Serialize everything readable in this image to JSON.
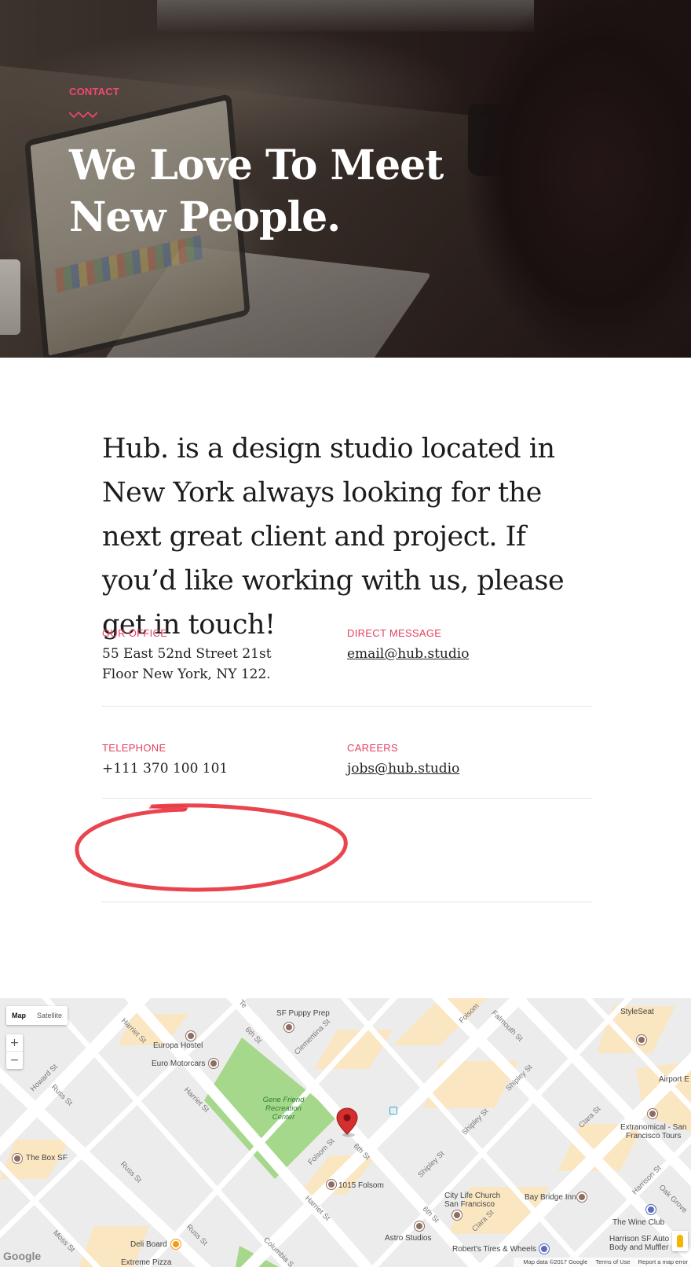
{
  "hero": {
    "eyebrow": "CONTACT",
    "title": "We Love To Meet New People."
  },
  "intro": "Hub. is a design studio located in New York always looking for the next great client and project. If you’d like working with us, please get in touch!",
  "contact": {
    "office_label": "OUR OFFICE",
    "office_value": "55 East 52nd Street 21st Floor New York, NY 122.",
    "message_label": "DIRECT MESSAGE",
    "message_value": "email@hub.studio",
    "phone_label": "TELEPHONE",
    "phone_value": "+111 370 100 101",
    "careers_label": "CAREERS",
    "careers_value": "jobs@hub.studio"
  },
  "colors": {
    "accent": "#e4415f",
    "annotation": "#e8343f",
    "park": "#a5d88a",
    "marker": "#d32f2f"
  },
  "map": {
    "type_map": "Map",
    "type_satellite": "Satellite",
    "zoom_in": "+",
    "zoom_out": "−",
    "attribution": "Map data ©2017 Google",
    "terms": "Terms of Use",
    "report": "Report a map error",
    "logo": "Google",
    "labels": {
      "puppy": "SF Puppy Prep",
      "hostel": "Europa Hostel",
      "motorcars": "Euro Motorcars",
      "park1": "Gene Friend",
      "park2": "Recreation",
      "park3": "Center",
      "stylesseat": "StyleSeat",
      "airport": "Airport E",
      "extranomical1": "Extranomical - San",
      "extranomical2": "Francisco Tours",
      "boxsf": "The Box SF",
      "folsom1015": "1015 Folsom",
      "church1": "City Life Church",
      "church2": "San Francisco",
      "bayinn": "Bay Bridge Inn",
      "wineclub": "The Wine Club",
      "astro": "Astro Studios",
      "harrison1": "Harrison SF Auto",
      "harrison2": "Body and Muffler",
      "robert": "Robert's Tires & Wheels",
      "deli": "Deli Board",
      "pizza": "Extreme Pizza"
    },
    "streets": {
      "howard": "Howard St",
      "russ1": "Russ St",
      "russ2": "Russ St",
      "russ3": "Russ St",
      "harriet1": "Harriet St",
      "harriet2": "Harriet St",
      "harriet3": "Harriet St",
      "sixth1": "6th St",
      "sixth2": "6th St",
      "sixth3": "6th St",
      "clementina": "Clementina St",
      "folsom1": "Folsom",
      "folsom2": "Folsom St",
      "falmouth": "Falmouth St",
      "shipley1": "Shipley St",
      "shipley2": "Shipley St",
      "shipley3": "Shipley St",
      "clara1": "Clara St",
      "clara2": "Clara St",
      "harrison": "Harrison St",
      "oak": "Oak Grove",
      "moss": "Moss St",
      "columbia": "Columbia S",
      "te": "Te"
    }
  }
}
